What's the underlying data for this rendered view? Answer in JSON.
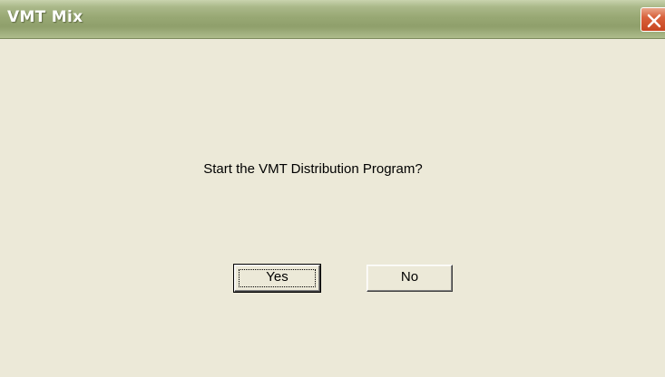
{
  "window": {
    "title": "VMT Mix"
  },
  "dialog": {
    "message": "Start the VMT Distribution Program?",
    "yes_label": "Yes",
    "no_label": "No"
  },
  "icons": {
    "close": "close-icon"
  },
  "colors": {
    "titlebar": "#98a874",
    "face": "#ece9d8",
    "close_button": "#d9623c"
  }
}
